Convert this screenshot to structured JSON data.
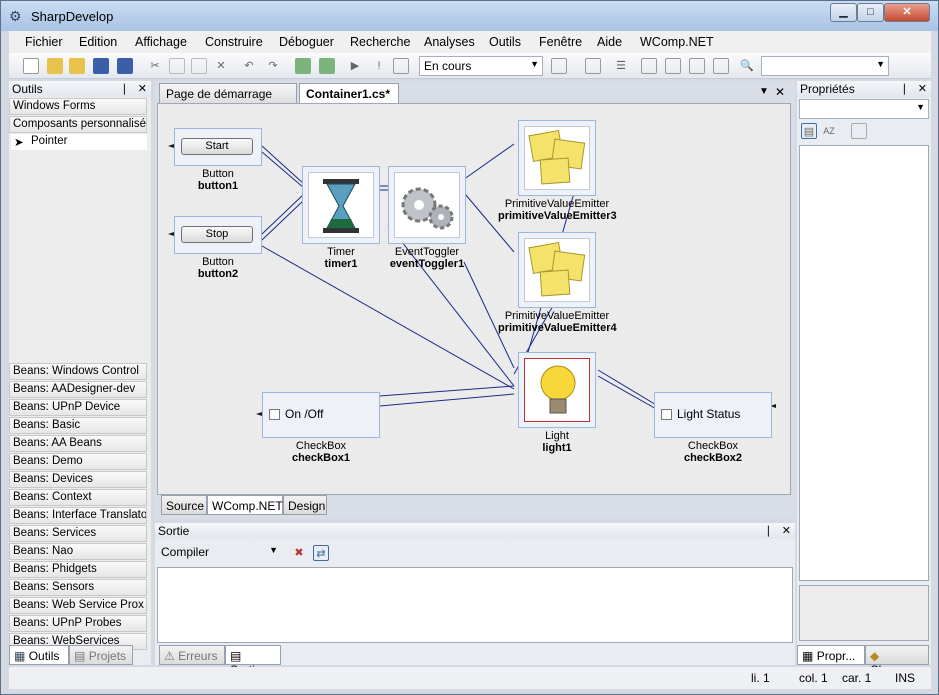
{
  "window": {
    "title": "SharpDevelop",
    "icon": "sharpdevelop-icon",
    "minimize": "▁",
    "maximize": "□",
    "close": "✕"
  },
  "menu": [
    "Fichier",
    "Edition",
    "Affichage",
    "Construire",
    "Déboguer",
    "Recherche",
    "Analyses",
    "Outils",
    "Fenêtre",
    "Aide",
    "WComp.NET"
  ],
  "toolbar": {
    "config_combo": "En cours",
    "search_combo": ""
  },
  "tools": {
    "title": "Outils",
    "pin": "❘",
    "close": "✕",
    "top_items": [
      "Windows Forms",
      "Composants personnalisé",
      "Pointer"
    ],
    "bean_items": [
      "Beans: Windows Control",
      "Beans: AADesigner-dev",
      "Beans: UPnP Device",
      "Beans: Basic",
      "Beans: AA Beans",
      "Beans: Demo",
      "Beans: Devices",
      "Beans: Context",
      "Beans: Interface Translato",
      "Beans: Services",
      "Beans: Nao",
      "Beans: Phidgets",
      "Beans: Sensors",
      "Beans: Web Service Prox",
      "Beans: UPnP Probes",
      "Beans: WebServices"
    ],
    "bottom_tabs": [
      "Outils",
      "Projets"
    ]
  },
  "editor": {
    "tabs": [
      "Page de démarrage",
      "Container1.cs*"
    ],
    "view_tabs": [
      "Source",
      "WComp.NET",
      "Design"
    ]
  },
  "components": {
    "button1": {
      "type": "Button",
      "name": "button1",
      "label": "Start"
    },
    "button2": {
      "type": "Button",
      "name": "button2",
      "label": "Stop"
    },
    "timer1": {
      "type": "Timer",
      "name": "timer1"
    },
    "eventToggler1": {
      "type": "EventToggler",
      "name": "eventToggler1"
    },
    "pve3": {
      "type": "PrimitiveValueEmitter",
      "name": "primitiveValueEmitter3"
    },
    "pve4": {
      "type": "PrimitiveValueEmitter",
      "name": "primitiveValueEmitter4"
    },
    "light1": {
      "type": "Light",
      "name": "light1"
    },
    "checkBox1": {
      "type": "CheckBox",
      "name": "checkBox1",
      "label": "On /Off"
    },
    "checkBox2": {
      "type": "CheckBox",
      "name": "checkBox2",
      "label": "Light Status"
    }
  },
  "output": {
    "title": "Sortie",
    "combo": "Compiler",
    "tabs": [
      "Erreurs",
      "Sortie"
    ]
  },
  "properties": {
    "title": "Propriétés",
    "tabs": [
      "Propr...",
      "Classes"
    ]
  },
  "status": {
    "line": "li. 1",
    "col": "col. 1",
    "car": "car. 1",
    "mode": "INS"
  }
}
